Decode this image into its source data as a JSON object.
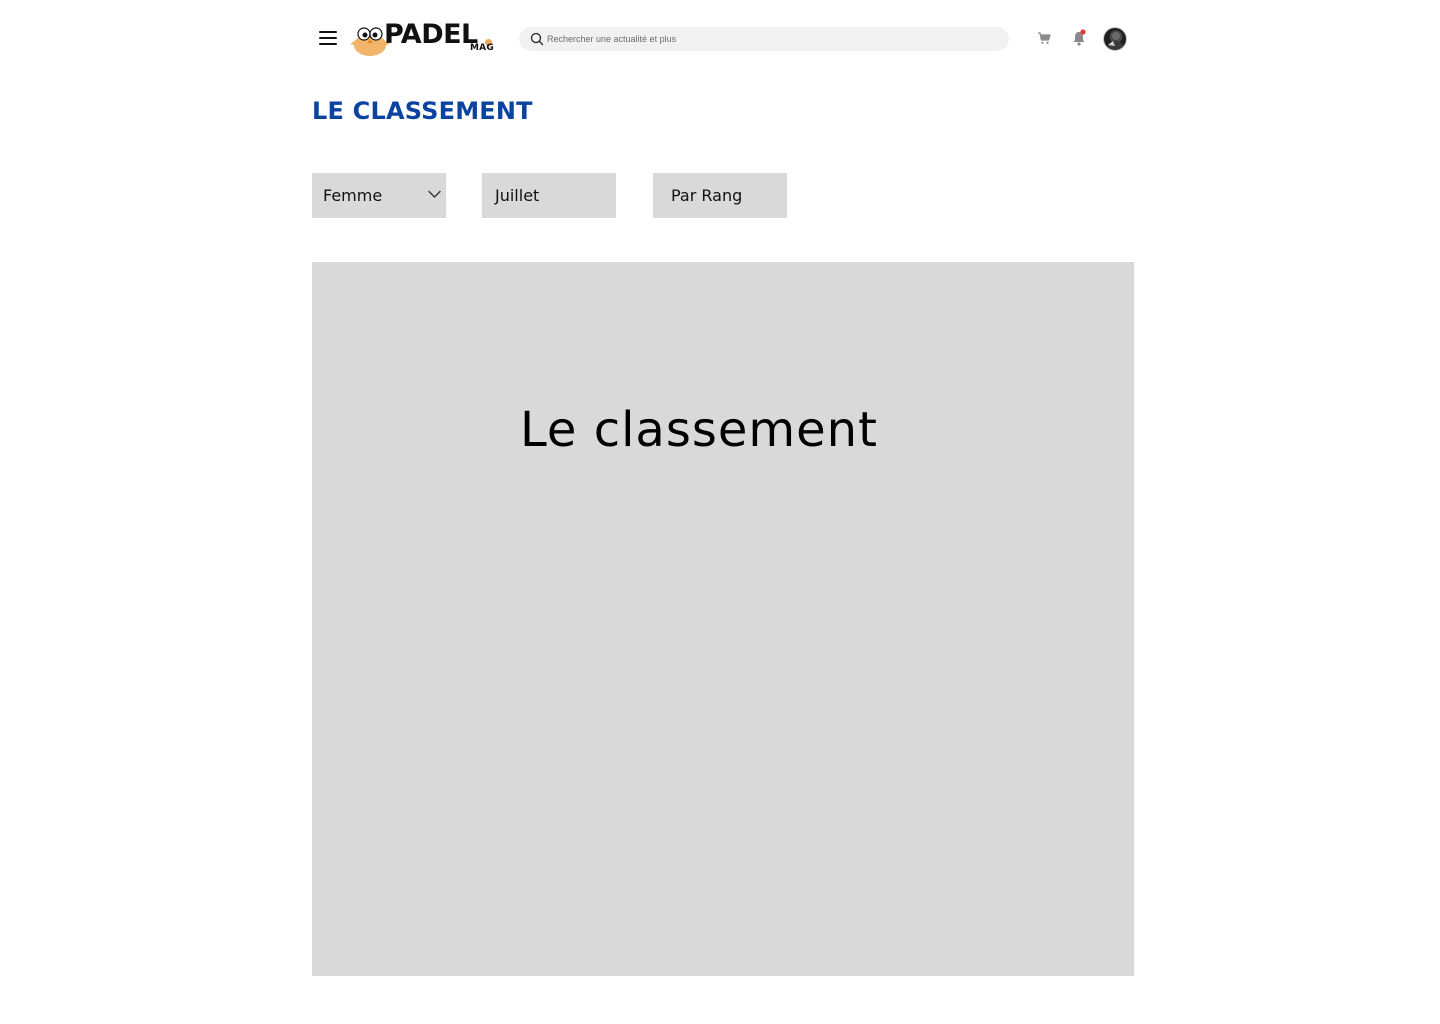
{
  "header": {
    "logo": {
      "brand": "PADEL",
      "sub": "MAG"
    },
    "search": {
      "placeholder": "Rechercher une actualité et plus"
    },
    "icons": [
      "menu-icon",
      "search-icon",
      "cart-icon",
      "bell-icon",
      "avatar"
    ],
    "notification_dot_color": "#e53935"
  },
  "main": {
    "title": "LE CLASSEMENT",
    "title_color": "#0b43a0",
    "filters": [
      {
        "label": "Femme",
        "has_dropdown": true
      },
      {
        "label": "Juillet"
      },
      {
        "label": "Par Rang"
      }
    ],
    "panel": {
      "text": "Le classement"
    }
  }
}
